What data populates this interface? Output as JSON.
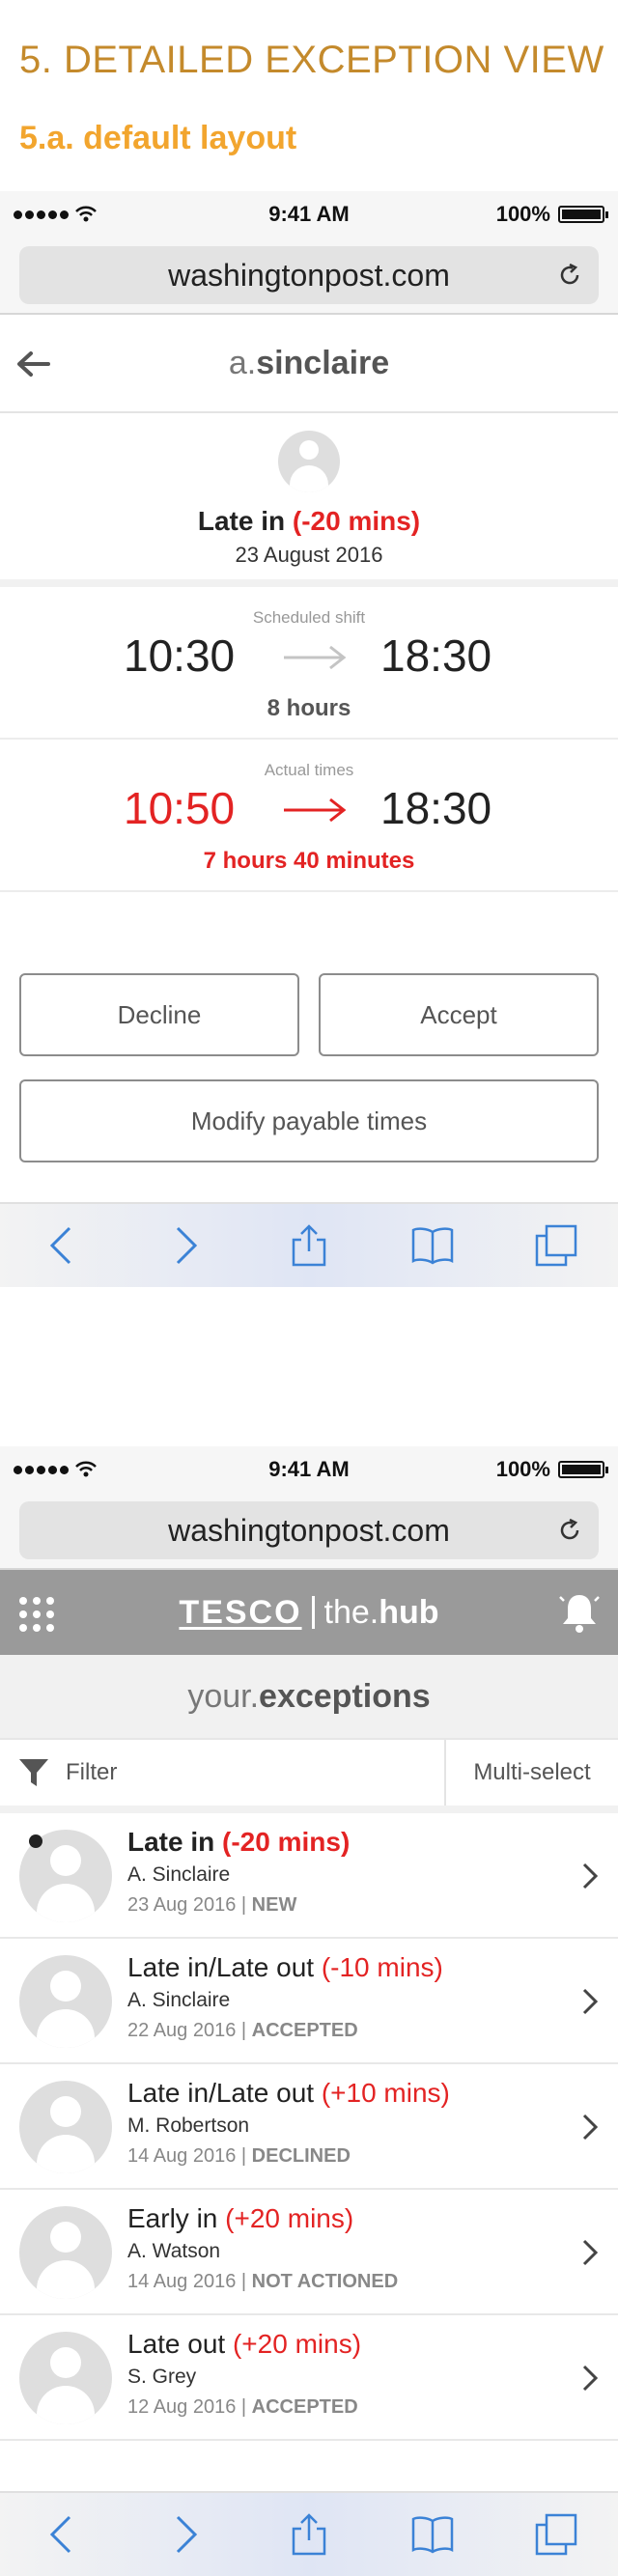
{
  "doc": {
    "heading": "5. DETAILED EXCEPTION VIEW",
    "subheading": "5.a. default layout"
  },
  "status_bar": {
    "time": "9:41 AM",
    "battery": "100%"
  },
  "browser": {
    "url": "washingtonpost.com"
  },
  "detail": {
    "header_prefix": "a.",
    "header_name": "sinclaire",
    "title_prefix": "Late in ",
    "title_delta": "(-20 mins)",
    "date": "23 August 2016",
    "scheduled": {
      "label": "Scheduled shift",
      "start": "10:30",
      "end": "18:30",
      "duration": "8 hours"
    },
    "actual": {
      "label": "Actual times",
      "start": "10:50",
      "end": "18:30",
      "duration": "7 hours 40 minutes"
    },
    "buttons": {
      "decline": "Decline",
      "accept": "Accept",
      "modify": "Modify payable times"
    }
  },
  "hub": {
    "brand_tesco": "TESCO",
    "brand_the": "the.",
    "brand_hub": "hub",
    "section_prefix": "your.",
    "section_name": "exceptions",
    "filter_label": "Filter",
    "multi_select_label": "Multi-select",
    "exceptions": [
      {
        "type": "Late in ",
        "delta": "(-20 mins)",
        "name": "A. Sinclaire",
        "date": "23 Aug 2016 | ",
        "status": "NEW",
        "unread": true
      },
      {
        "type": "Late in/Late out ",
        "delta": "(-10 mins)",
        "name": "A. Sinclaire",
        "date": "22 Aug 2016 | ",
        "status": "ACCEPTED",
        "unread": false
      },
      {
        "type": "Late in/Late out ",
        "delta": "(+10 mins)",
        "name": "M. Robertson",
        "date": "14 Aug 2016 | ",
        "status": "DECLINED",
        "unread": false
      },
      {
        "type": "Early in ",
        "delta": "(+20 mins)",
        "name": "A. Watson",
        "date": "14 Aug 2016 | ",
        "status": "NOT ACTIONED",
        "unread": false
      },
      {
        "type": "Late out ",
        "delta": "(+20 mins)",
        "name": "S. Grey",
        "date": "12 Aug 2016 | ",
        "status": "ACCEPTED",
        "unread": false
      }
    ]
  },
  "colors": {
    "accent_heading": "#c48a2c",
    "accent_sub": "#f2a52e",
    "alert_red": "#e32323",
    "ios_blue": "#3b82d6"
  },
  "icons": [
    "back-arrow-icon",
    "reload-icon",
    "chevron-left-icon",
    "chevron-right-icon",
    "share-icon",
    "bookmarks-icon",
    "tabs-icon",
    "grid-icon",
    "bell-icon",
    "filter-icon",
    "chevron-icon"
  ]
}
